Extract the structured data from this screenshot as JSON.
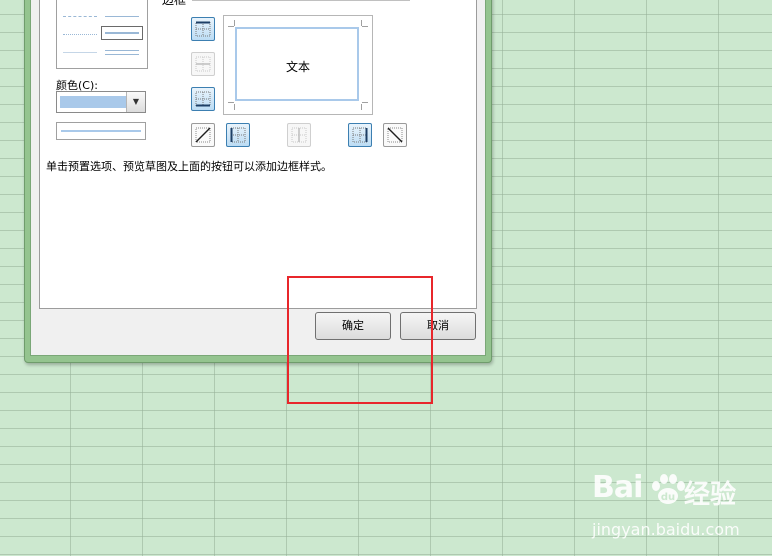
{
  "dialog": {
    "color_label": "颜色(C):",
    "border_group_title": "边框",
    "preview_text": "文本",
    "hint": "单击预置选项、预览草图及上面的按钮可以添加边框样式。",
    "line_color": "#a9c9ea"
  },
  "buttons": {
    "ok_label": "确定",
    "cancel_label": "取消"
  },
  "border_buttons": {
    "left_column": [
      "top-border",
      "inside-horizontal-border",
      "bottom-border"
    ],
    "bottom_row": [
      "diagonal-up-border",
      "left-border",
      "inside-vertical-border",
      "right-border",
      "diagonal-down-border"
    ],
    "active": [
      "top-border",
      "bottom-border",
      "left-border",
      "right-border"
    ],
    "disabled": [
      "inside-horizontal-border",
      "inside-vertical-border"
    ]
  },
  "watermark": {
    "logo_left": "Bai",
    "logo_right": "经验",
    "url": "jingyan.baidu.com"
  },
  "annotation": {
    "highlight_color": "#e8262b"
  }
}
